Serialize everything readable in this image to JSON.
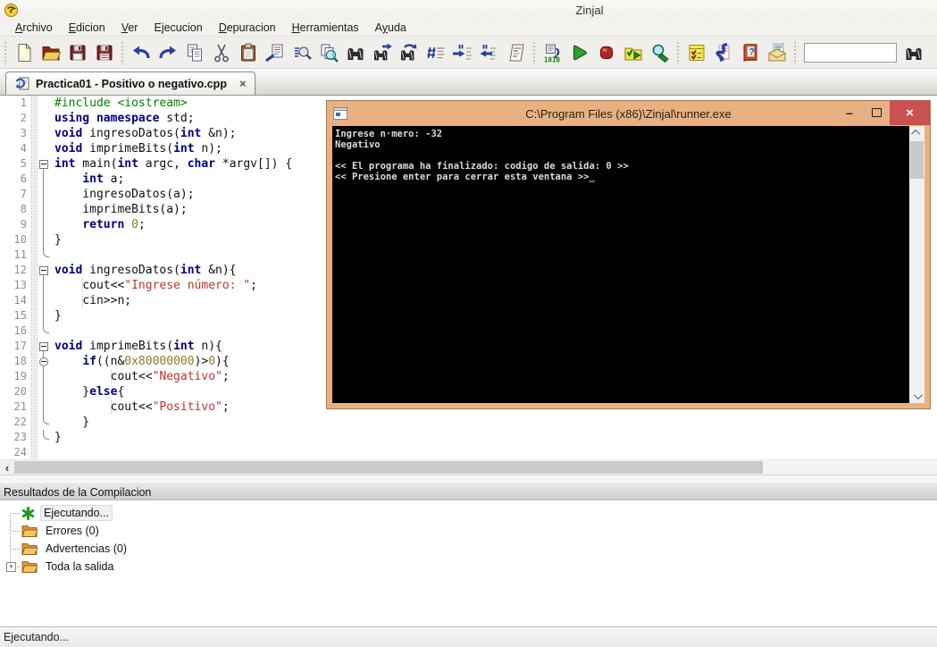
{
  "window": {
    "title": "Zinjal",
    "app_icon": "zinjal-logo"
  },
  "menu": {
    "items": [
      {
        "label": "Archivo",
        "u": 0
      },
      {
        "label": "Edicion",
        "u": 0
      },
      {
        "label": "Ver",
        "u": 0
      },
      {
        "label": "Ejecucion",
        "u": -1
      },
      {
        "label": "Depuracion",
        "u": 0
      },
      {
        "label": "Herramientas",
        "u": 0
      },
      {
        "label": "Ayuda",
        "u": 1
      }
    ]
  },
  "toolbar": {
    "search_value": "",
    "icons": [
      "new-file",
      "open-file",
      "save",
      "save-all",
      "undo",
      "redo",
      "copy",
      "cut",
      "paste",
      "paste-insert",
      "find",
      "find-in-files",
      "find-binoculars",
      "find-next",
      "replace",
      "goto-line",
      "comment",
      "uncomment",
      "format-code",
      "compile",
      "run",
      "stop",
      "compile-and-run",
      "debug",
      "tasks",
      "help-index",
      "help",
      "send-results",
      "search-box",
      "search-binoculars"
    ]
  },
  "tab": {
    "label": "Practica01 - Positivo o negativo.cpp",
    "close": "×"
  },
  "editor": {
    "lines": [
      {
        "n": 1,
        "fold": "",
        "segs": [
          {
            "c": "p",
            "t": "#include <iostream>"
          }
        ]
      },
      {
        "n": 2,
        "fold": "",
        "segs": [
          {
            "c": "k",
            "t": "using"
          },
          {
            "c": "d",
            "t": " "
          },
          {
            "c": "k",
            "t": "namespace"
          },
          {
            "c": "d",
            "t": " std;"
          }
        ]
      },
      {
        "n": 3,
        "fold": "",
        "segs": [
          {
            "c": "k",
            "t": "void"
          },
          {
            "c": "d",
            "t": " ingresoDatos("
          },
          {
            "c": "k",
            "t": "int"
          },
          {
            "c": "d",
            "t": " &n);"
          }
        ]
      },
      {
        "n": 4,
        "fold": "",
        "segs": [
          {
            "c": "k",
            "t": "void"
          },
          {
            "c": "d",
            "t": " imprimeBits("
          },
          {
            "c": "k",
            "t": "int"
          },
          {
            "c": "d",
            "t": " n);"
          }
        ]
      },
      {
        "n": 5,
        "fold": "box",
        "segs": [
          {
            "c": "k",
            "t": "int"
          },
          {
            "c": "d",
            "t": " main("
          },
          {
            "c": "k",
            "t": "int"
          },
          {
            "c": "d",
            "t": " argc, "
          },
          {
            "c": "k",
            "t": "char"
          },
          {
            "c": "d",
            "t": " *argv[]) {"
          }
        ]
      },
      {
        "n": 6,
        "fold": "v",
        "segs": [
          {
            "c": "d",
            "t": "    "
          },
          {
            "c": "k",
            "t": "int"
          },
          {
            "c": "d",
            "t": " a;"
          }
        ]
      },
      {
        "n": 7,
        "fold": "v",
        "segs": [
          {
            "c": "d",
            "t": "    ingresoDatos(a);"
          }
        ]
      },
      {
        "n": 8,
        "fold": "v",
        "segs": [
          {
            "c": "d",
            "t": "    imprimeBits(a);"
          }
        ]
      },
      {
        "n": 9,
        "fold": "v",
        "segs": [
          {
            "c": "d",
            "t": "    "
          },
          {
            "c": "k",
            "t": "return"
          },
          {
            "c": "d",
            "t": " "
          },
          {
            "c": "n",
            "t": "0"
          },
          {
            "c": "d",
            "t": ";"
          }
        ]
      },
      {
        "n": 10,
        "fold": "v",
        "segs": [
          {
            "c": "d",
            "t": "}"
          }
        ]
      },
      {
        "n": 11,
        "fold": "end",
        "segs": []
      },
      {
        "n": 12,
        "fold": "box",
        "segs": [
          {
            "c": "k",
            "t": "void"
          },
          {
            "c": "d",
            "t": " ingresoDatos("
          },
          {
            "c": "k",
            "t": "int"
          },
          {
            "c": "d",
            "t": " &n){"
          }
        ]
      },
      {
        "n": 13,
        "fold": "v",
        "guides": [
          4
        ],
        "segs": [
          {
            "c": "d",
            "t": "    cout<<"
          },
          {
            "c": "s",
            "t": "\"Ingrese número: \""
          },
          {
            "c": "d",
            "t": ";"
          }
        ]
      },
      {
        "n": 14,
        "fold": "v",
        "guides": [
          4
        ],
        "segs": [
          {
            "c": "d",
            "t": "    cin>>n;"
          }
        ]
      },
      {
        "n": 15,
        "fold": "v",
        "segs": [
          {
            "c": "d",
            "t": "}"
          }
        ]
      },
      {
        "n": 16,
        "fold": "end",
        "segs": []
      },
      {
        "n": 17,
        "fold": "box",
        "segs": [
          {
            "c": "k",
            "t": "void"
          },
          {
            "c": "d",
            "t": " imprimeBits("
          },
          {
            "c": "k",
            "t": "int"
          },
          {
            "c": "d",
            "t": " n){"
          }
        ]
      },
      {
        "n": 18,
        "fold": "circ",
        "segs": [
          {
            "c": "d",
            "t": "    "
          },
          {
            "c": "k",
            "t": "if"
          },
          {
            "c": "d",
            "t": "((n&"
          },
          {
            "c": "n",
            "t": "0x80000000"
          },
          {
            "c": "d",
            "t": ")>"
          },
          {
            "c": "n",
            "t": "0"
          },
          {
            "c": "d",
            "t": "){"
          }
        ]
      },
      {
        "n": 19,
        "fold": "v",
        "guides": [
          8
        ],
        "segs": [
          {
            "c": "d",
            "t": "        cout<<"
          },
          {
            "c": "s",
            "t": "\"Negativo\""
          },
          {
            "c": "d",
            "t": ";"
          }
        ]
      },
      {
        "n": 20,
        "fold": "v",
        "segs": [
          {
            "c": "d",
            "t": "    }"
          },
          {
            "c": "k",
            "t": "else"
          },
          {
            "c": "d",
            "t": "{"
          }
        ]
      },
      {
        "n": 21,
        "fold": "v",
        "guides": [
          8
        ],
        "segs": [
          {
            "c": "d",
            "t": "        cout<<"
          },
          {
            "c": "s",
            "t": "\"Positivo\""
          },
          {
            "c": "d",
            "t": ";"
          }
        ]
      },
      {
        "n": 22,
        "fold": "end",
        "segs": [
          {
            "c": "d",
            "t": "    }"
          }
        ]
      },
      {
        "n": 23,
        "fold": "end",
        "segs": [
          {
            "c": "d",
            "t": "}"
          }
        ]
      },
      {
        "n": 24,
        "fold": "",
        "segs": []
      }
    ]
  },
  "hscroll": {
    "arrow": "‹"
  },
  "console": {
    "title": "C:\\Program Files (x86)\\Zinjal\\runner.exe",
    "minimize": "–",
    "close": "×",
    "lines": [
      "Ingrese n·mero: -32",
      "Negativo",
      "",
      "<< El programa ha finalizado: codigo de salida: 0 >>",
      "<< Presione enter para cerrar esta ventana >>"
    ],
    "cursor": "_"
  },
  "results": {
    "header": "Resultados de la Compilacion",
    "items": [
      {
        "icon": "run-star",
        "label": "Ejecutando...",
        "selected": true
      },
      {
        "icon": "folder",
        "label": "Errores (0)"
      },
      {
        "icon": "folder",
        "label": "Advertencias (0)"
      },
      {
        "icon": "folder",
        "label": "Toda la salida",
        "expandable": true,
        "expand_glyph": "+"
      }
    ]
  },
  "statusbar": {
    "text": "Ejecutando..."
  }
}
